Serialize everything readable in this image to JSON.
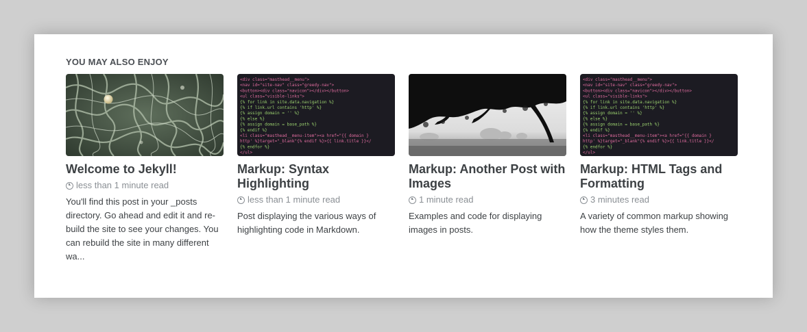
{
  "section": {
    "title": "YOU MAY ALSO ENJOY"
  },
  "cards": [
    {
      "title": "Welcome to Jekyll!",
      "meta": "less than 1 minute read",
      "excerpt": "You'll find this post in your _posts directory. Go ahead and edit it and re-build the site to see your changes. You can rebuild the site in many different wa...",
      "image": "organic-cells-photo"
    },
    {
      "title": "Markup: Syntax Highlighting",
      "meta": "less than 1 minute read",
      "excerpt": "Post displaying the various ways of highlighting code in Markdown.",
      "image": "code-screenshot"
    },
    {
      "title": "Markup: Another Post with Images",
      "meta": "1 minute read",
      "excerpt": "Examples and code for displaying images in posts.",
      "image": "tree-silhouette-photo"
    },
    {
      "title": "Markup: HTML Tags and Formatting",
      "meta": "3 minutes read",
      "excerpt": "A variety of common markup showing how the theme styles them.",
      "image": "code-screenshot"
    }
  ],
  "code_lines": [
    "<div class=\"masthead__menu\">",
    "  <nav id=\"site-nav\" class=\"greedy-nav\">",
    "    <button><div class=\"navicon\"></div></button>",
    "    <ul class=\"visible-links\">",
    "      {% for link in site.data.navigation %}",
    "        {% if link.url contains 'http' %}",
    "          {% assign domain = '' %}",
    "          {% else %}",
    "          {% assign domain = base_path %}",
    "        {% endif %}",
    "        <li class=\"masthead__menu-item\"><a href=\"{{ domain }",
    "        http' %}target=\"_blank\"{% endif %}>{{ link.title }}</",
    "      {% endfor %}",
    "    </ul>"
  ],
  "colors": {
    "background": "#cfcfcf",
    "panel": "#ffffff",
    "text": "#3d4144",
    "meta": "#8a8f94",
    "code_bg": "#1c1b22"
  }
}
